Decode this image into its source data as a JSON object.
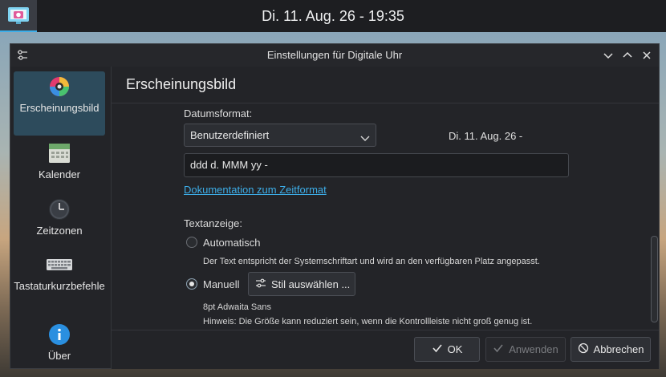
{
  "panel": {
    "clock": "Di. 11. Aug. 26 - 19:35",
    "launcher_icon": "screenshot-app-icon"
  },
  "window": {
    "title": "Einstellungen für Digitale Uhr"
  },
  "sidebar": {
    "items": [
      {
        "label": "Erscheinungsbild",
        "icon": "color-wheel-icon",
        "active": true
      },
      {
        "label": "Kalender",
        "icon": "calendar-icon"
      },
      {
        "label": "Zeitzonen",
        "icon": "clock-icon"
      },
      {
        "label": "Tastaturkurzbefehle",
        "icon": "keyboard-icon"
      },
      {
        "label": "Über",
        "icon": "info-icon"
      }
    ]
  },
  "page": {
    "title": "Erscheinungsbild"
  },
  "date_format": {
    "label": "Datumsformat:",
    "selected": "Benutzerdefiniert",
    "preview": "Di. 11. Aug. 26 -",
    "custom_value": "ddd d. MMM yy -",
    "doc_link": "Dokumentation zum Zeitformat"
  },
  "text_display": {
    "label": "Textanzeige:",
    "auto_label": "Automatisch",
    "auto_hint": "Der Text entspricht der Systemschriftart und wird an den verfügbaren Platz angepasst.",
    "manual_label": "Manuell",
    "style_button": "Stil auswählen ...",
    "font_info": "8pt Adwaita Sans",
    "size_hint": "Hinweis: Die Größe kann reduziert sein, wenn die Kontrollleiste nicht groß genug ist.",
    "selected": "manual"
  },
  "footer": {
    "ok": "OK",
    "apply": "Anwenden",
    "cancel": "Abbrechen"
  },
  "colors": {
    "accent": "#3daee9",
    "selection": "#2d4b5c",
    "window_bg": "#232428"
  }
}
